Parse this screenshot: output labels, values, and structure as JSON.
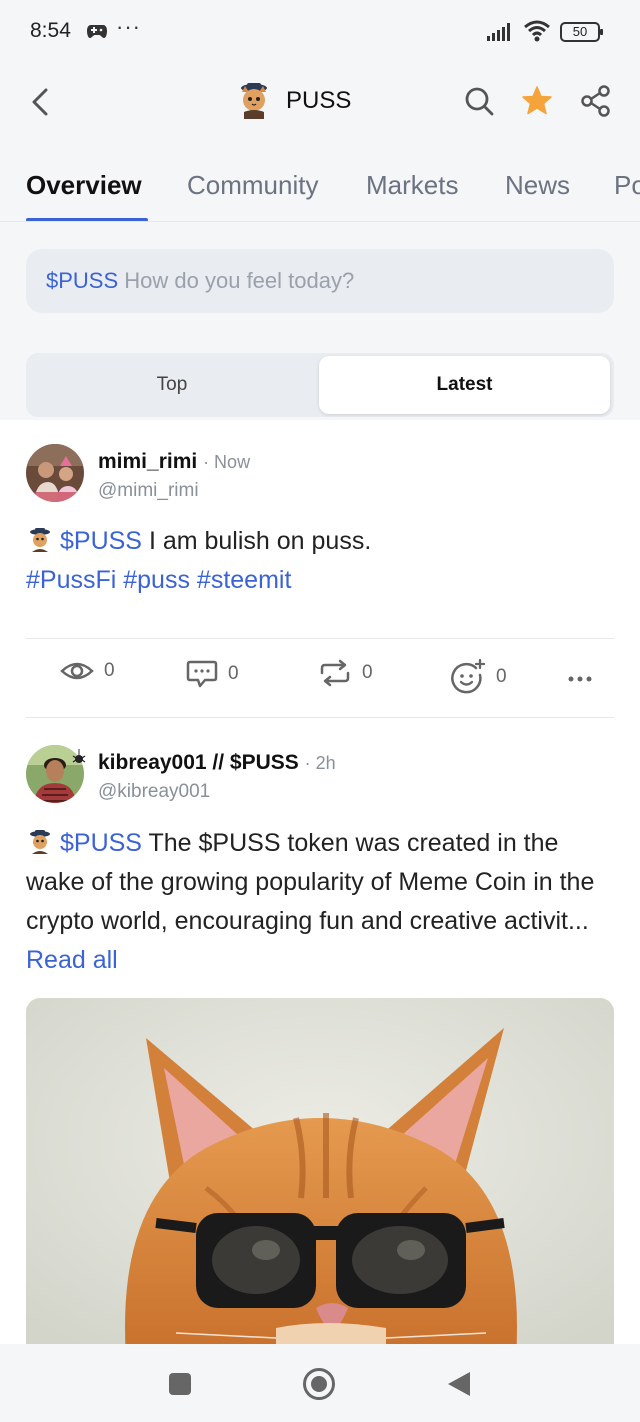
{
  "status_bar": {
    "time": "8:54",
    "battery": "50"
  },
  "header": {
    "title": "PUSS"
  },
  "tabs": [
    {
      "label": "Overview"
    },
    {
      "label": "Community"
    },
    {
      "label": "Markets"
    },
    {
      "label": "News"
    },
    {
      "label": "Po"
    }
  ],
  "compose": {
    "ticker": "$PUSS",
    "placeholder": "How do you feel today?"
  },
  "feed_toggle": {
    "top": "Top",
    "latest": "Latest"
  },
  "posts": [
    {
      "name": "mimi_rimi",
      "time": "· Now",
      "handle": "@mimi_rimi",
      "ticker": "$PUSS",
      "text": "I am bulish on puss.",
      "hashtags": "#PussFi #puss #steemit",
      "views": "0",
      "comments": "0",
      "reposts": "0",
      "reactions": "0"
    },
    {
      "name": "kibreay001 // $PUSS",
      "time": "· 2h",
      "handle": "@kibreay001",
      "ticker": "$PUSS",
      "text": "The $PUSS token was created in the wake of the growing popularity of Meme Coin in the crypto world, encouraging fun and creative activit...",
      "read_all": "Read all"
    }
  ],
  "colors": {
    "accent": "#3b63d6",
    "star": "#f5a33b",
    "page_bg": "#f5f6f8"
  }
}
